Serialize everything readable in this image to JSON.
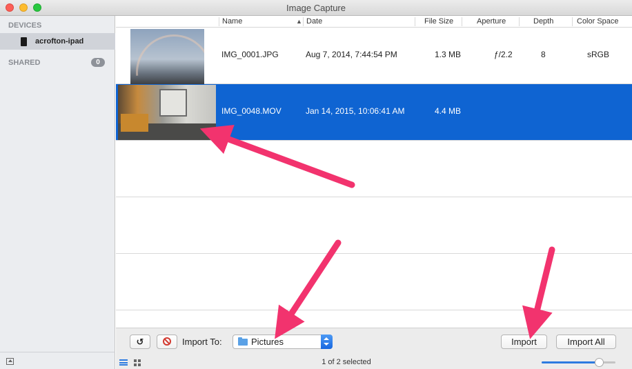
{
  "window": {
    "title": "Image Capture"
  },
  "sidebar": {
    "devices_heading": "DEVICES",
    "device_name": "acrofton-ipad",
    "shared_heading": "SHARED",
    "shared_count": "0"
  },
  "table": {
    "columns": {
      "name": "Name",
      "date": "Date",
      "file_size": "File Size",
      "aperture": "Aperture",
      "depth": "Depth",
      "color_space": "Color Space"
    },
    "rows": [
      {
        "name": "IMG_0001.JPG",
        "date": "Aug 7, 2014, 7:44:54 PM",
        "file_size": "1.3 MB",
        "aperture": "ƒ/2.2",
        "depth": "8",
        "color_space": "sRGB",
        "thumbnail": "sky-rainbow-photo",
        "selected": false
      },
      {
        "name": "IMG_0048.MOV",
        "date": "Jan 14, 2015, 10:06:41 AM",
        "file_size": "4.4 MB",
        "aperture": "",
        "depth": "",
        "color_space": "",
        "thumbnail": "office-room-video",
        "selected": true
      }
    ]
  },
  "toolbar": {
    "import_to_label": "Import To:",
    "destination": "Pictures",
    "import_label": "Import",
    "import_all_label": "Import All",
    "rotate_icon": "rotate-left-icon",
    "delete_icon": "delete-prohibited-icon"
  },
  "status": {
    "selection_text": "1 of 2 selected",
    "thumbnail_size_fraction": 0.78
  },
  "colors": {
    "selection": "#0f64d2",
    "annotation_arrow": "#f2336e"
  }
}
